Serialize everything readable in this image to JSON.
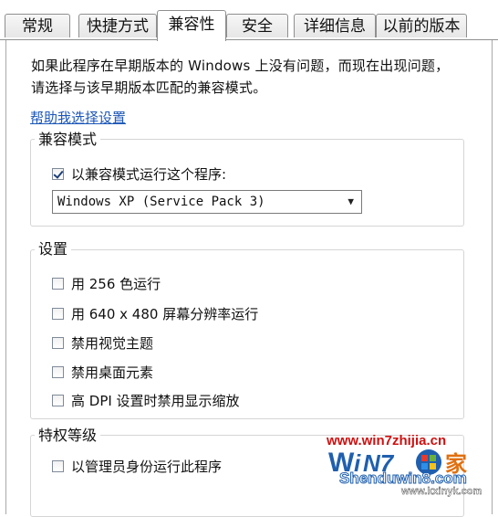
{
  "tabs": [
    "常规",
    "快捷方式",
    "兼容性",
    "安全",
    "详细信息",
    "以前的版本"
  ],
  "intro_text": "如果此程序在早期版本的 Windows 上没有问题，而现在出现问题，请选择与该早期版本匹配的兼容模式。",
  "help_link": "帮助我选择设置",
  "compat_group": {
    "title": "兼容模式",
    "checkbox_label": "以兼容模式运行这个程序:",
    "checked": true,
    "selected_os": "Windows XP (Service Pack 3)"
  },
  "settings_group": {
    "title": "设置",
    "options": [
      {
        "label": "用 256 色运行",
        "checked": false
      },
      {
        "label": "用 640 x 480 屏幕分辨率运行",
        "checked": false
      },
      {
        "label": "禁用视觉主题",
        "checked": false
      },
      {
        "label": "禁用桌面元素",
        "checked": false
      },
      {
        "label": "高 DPI 设置时禁用显示缩放",
        "checked": false
      }
    ]
  },
  "privilege_group": {
    "title": "特权等级",
    "checkbox_label": "以管理员身份运行此程序",
    "checked": false
  },
  "watermark": {
    "url_top": "www.win7zhijia.cn",
    "brand": "Shenduwin8.com",
    "url_bottom": "www.kxinyk.com"
  }
}
